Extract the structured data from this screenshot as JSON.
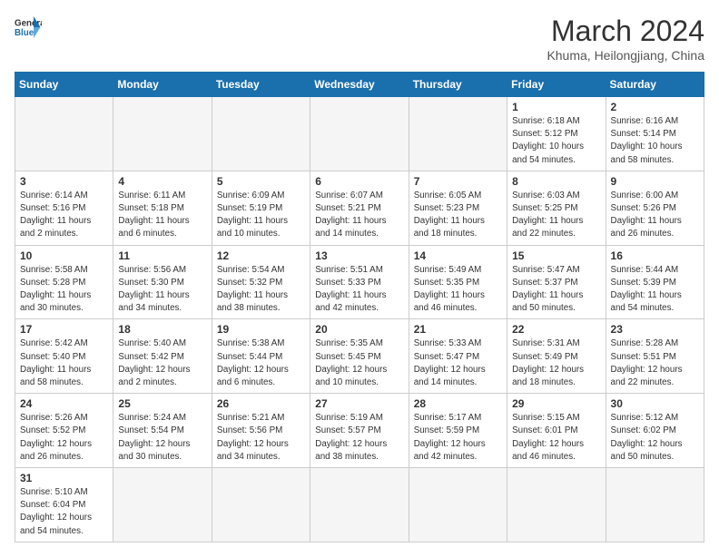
{
  "header": {
    "logo_general": "General",
    "logo_blue": "Blue",
    "month_title": "March 2024",
    "subtitle": "Khuma, Heilongjiang, China"
  },
  "weekdays": [
    "Sunday",
    "Monday",
    "Tuesday",
    "Wednesday",
    "Thursday",
    "Friday",
    "Saturday"
  ],
  "weeks": [
    [
      {
        "day": "",
        "info": ""
      },
      {
        "day": "",
        "info": ""
      },
      {
        "day": "",
        "info": ""
      },
      {
        "day": "",
        "info": ""
      },
      {
        "day": "",
        "info": ""
      },
      {
        "day": "1",
        "info": "Sunrise: 6:18 AM\nSunset: 5:12 PM\nDaylight: 10 hours\nand 54 minutes."
      },
      {
        "day": "2",
        "info": "Sunrise: 6:16 AM\nSunset: 5:14 PM\nDaylight: 10 hours\nand 58 minutes."
      }
    ],
    [
      {
        "day": "3",
        "info": "Sunrise: 6:14 AM\nSunset: 5:16 PM\nDaylight: 11 hours\nand 2 minutes."
      },
      {
        "day": "4",
        "info": "Sunrise: 6:11 AM\nSunset: 5:18 PM\nDaylight: 11 hours\nand 6 minutes."
      },
      {
        "day": "5",
        "info": "Sunrise: 6:09 AM\nSunset: 5:19 PM\nDaylight: 11 hours\nand 10 minutes."
      },
      {
        "day": "6",
        "info": "Sunrise: 6:07 AM\nSunset: 5:21 PM\nDaylight: 11 hours\nand 14 minutes."
      },
      {
        "day": "7",
        "info": "Sunrise: 6:05 AM\nSunset: 5:23 PM\nDaylight: 11 hours\nand 18 minutes."
      },
      {
        "day": "8",
        "info": "Sunrise: 6:03 AM\nSunset: 5:25 PM\nDaylight: 11 hours\nand 22 minutes."
      },
      {
        "day": "9",
        "info": "Sunrise: 6:00 AM\nSunset: 5:26 PM\nDaylight: 11 hours\nand 26 minutes."
      }
    ],
    [
      {
        "day": "10",
        "info": "Sunrise: 5:58 AM\nSunset: 5:28 PM\nDaylight: 11 hours\nand 30 minutes."
      },
      {
        "day": "11",
        "info": "Sunrise: 5:56 AM\nSunset: 5:30 PM\nDaylight: 11 hours\nand 34 minutes."
      },
      {
        "day": "12",
        "info": "Sunrise: 5:54 AM\nSunset: 5:32 PM\nDaylight: 11 hours\nand 38 minutes."
      },
      {
        "day": "13",
        "info": "Sunrise: 5:51 AM\nSunset: 5:33 PM\nDaylight: 11 hours\nand 42 minutes."
      },
      {
        "day": "14",
        "info": "Sunrise: 5:49 AM\nSunset: 5:35 PM\nDaylight: 11 hours\nand 46 minutes."
      },
      {
        "day": "15",
        "info": "Sunrise: 5:47 AM\nSunset: 5:37 PM\nDaylight: 11 hours\nand 50 minutes."
      },
      {
        "day": "16",
        "info": "Sunrise: 5:44 AM\nSunset: 5:39 PM\nDaylight: 11 hours\nand 54 minutes."
      }
    ],
    [
      {
        "day": "17",
        "info": "Sunrise: 5:42 AM\nSunset: 5:40 PM\nDaylight: 11 hours\nand 58 minutes."
      },
      {
        "day": "18",
        "info": "Sunrise: 5:40 AM\nSunset: 5:42 PM\nDaylight: 12 hours\nand 2 minutes."
      },
      {
        "day": "19",
        "info": "Sunrise: 5:38 AM\nSunset: 5:44 PM\nDaylight: 12 hours\nand 6 minutes."
      },
      {
        "day": "20",
        "info": "Sunrise: 5:35 AM\nSunset: 5:45 PM\nDaylight: 12 hours\nand 10 minutes."
      },
      {
        "day": "21",
        "info": "Sunrise: 5:33 AM\nSunset: 5:47 PM\nDaylight: 12 hours\nand 14 minutes."
      },
      {
        "day": "22",
        "info": "Sunrise: 5:31 AM\nSunset: 5:49 PM\nDaylight: 12 hours\nand 18 minutes."
      },
      {
        "day": "23",
        "info": "Sunrise: 5:28 AM\nSunset: 5:51 PM\nDaylight: 12 hours\nand 22 minutes."
      }
    ],
    [
      {
        "day": "24",
        "info": "Sunrise: 5:26 AM\nSunset: 5:52 PM\nDaylight: 12 hours\nand 26 minutes."
      },
      {
        "day": "25",
        "info": "Sunrise: 5:24 AM\nSunset: 5:54 PM\nDaylight: 12 hours\nand 30 minutes."
      },
      {
        "day": "26",
        "info": "Sunrise: 5:21 AM\nSunset: 5:56 PM\nDaylight: 12 hours\nand 34 minutes."
      },
      {
        "day": "27",
        "info": "Sunrise: 5:19 AM\nSunset: 5:57 PM\nDaylight: 12 hours\nand 38 minutes."
      },
      {
        "day": "28",
        "info": "Sunrise: 5:17 AM\nSunset: 5:59 PM\nDaylight: 12 hours\nand 42 minutes."
      },
      {
        "day": "29",
        "info": "Sunrise: 5:15 AM\nSunset: 6:01 PM\nDaylight: 12 hours\nand 46 minutes."
      },
      {
        "day": "30",
        "info": "Sunrise: 5:12 AM\nSunset: 6:02 PM\nDaylight: 12 hours\nand 50 minutes."
      }
    ],
    [
      {
        "day": "31",
        "info": "Sunrise: 5:10 AM\nSunset: 6:04 PM\nDaylight: 12 hours\nand 54 minutes."
      },
      {
        "day": "",
        "info": ""
      },
      {
        "day": "",
        "info": ""
      },
      {
        "day": "",
        "info": ""
      },
      {
        "day": "",
        "info": ""
      },
      {
        "day": "",
        "info": ""
      },
      {
        "day": "",
        "info": ""
      }
    ]
  ]
}
